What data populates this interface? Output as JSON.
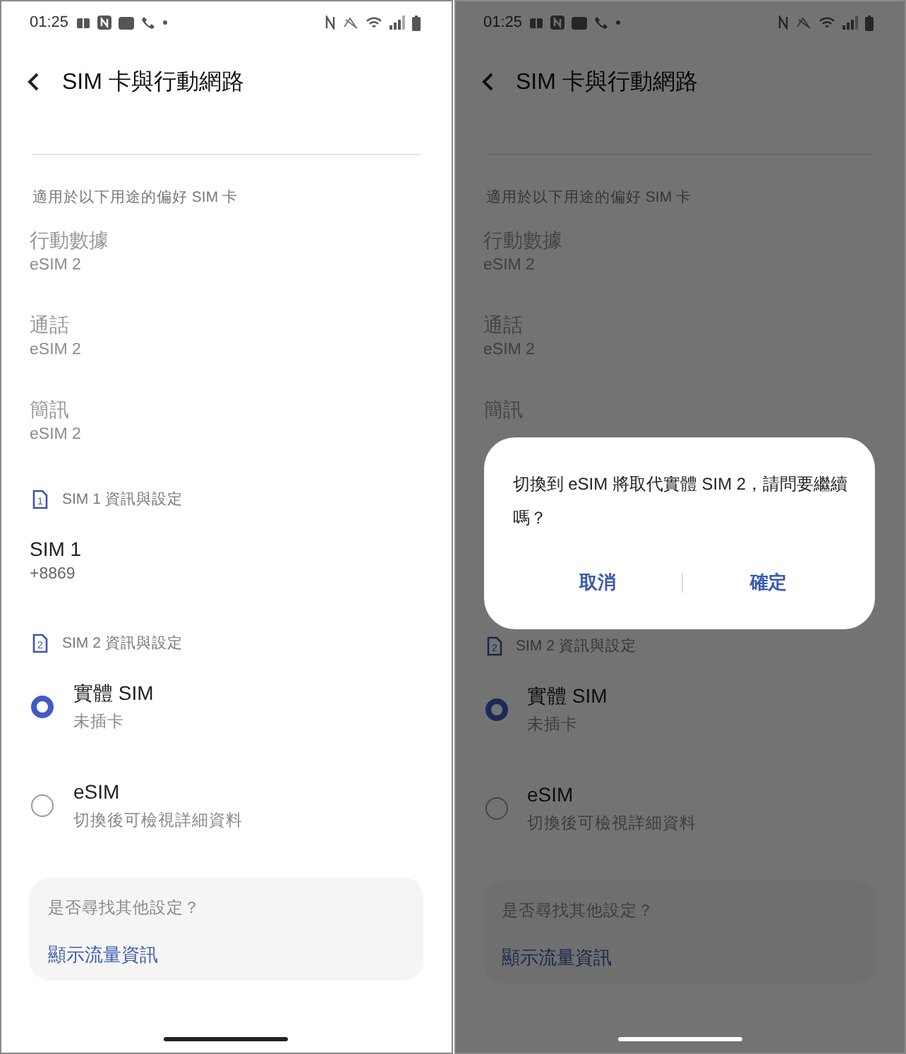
{
  "screens": [
    {
      "status_time": "01:25",
      "title": "SIM 卡與行動網路",
      "preferred_header": "適用於以下用途的偏好 SIM 卡",
      "preferences": [
        {
          "label": "行動數據",
          "value": "eSIM 2"
        },
        {
          "label": "通話",
          "value": "eSIM 2"
        },
        {
          "label": "簡訊",
          "value": "eSIM 2"
        }
      ],
      "sim1": {
        "icon_label": "1",
        "header": "SIM 1 資訊與設定",
        "name": "SIM 1",
        "number": "+8869"
      },
      "sim2": {
        "icon_label": "2",
        "header": "SIM 2 資訊與設定",
        "options": [
          {
            "label": "實體 SIM",
            "subtitle": "未插卡",
            "selected": true
          },
          {
            "label": "eSIM",
            "subtitle": "切換後可檢視詳細資料",
            "selected": false
          }
        ]
      },
      "suggestion": {
        "question": "是否尋找其他設定？",
        "link": "顯示流量資訊"
      }
    },
    {
      "status_time": "01:25",
      "title": "SIM 卡與行動網路",
      "preferred_header": "適用於以下用途的偏好 SIM 卡",
      "preferences": [
        {
          "label": "行動數據",
          "value": "eSIM 2"
        },
        {
          "label": "通話",
          "value": "eSIM 2"
        },
        {
          "label": "簡訊"
        }
      ],
      "sim2": {
        "icon_label": "2",
        "header": "SIM 2 資訊與設定",
        "options": [
          {
            "label": "實體 SIM",
            "subtitle": "未插卡",
            "selected": true
          },
          {
            "label": "eSIM",
            "subtitle": "切換後可檢視詳細資料",
            "selected": false
          }
        ]
      },
      "suggestion": {
        "question": "是否尋找其他設定？",
        "link": "顯示流量資訊"
      },
      "dialog": {
        "message": "切換到 eSIM 將取代實體 SIM 2，請問要繼續嗎？",
        "buttons": [
          "取消",
          "確定"
        ]
      }
    }
  ]
}
